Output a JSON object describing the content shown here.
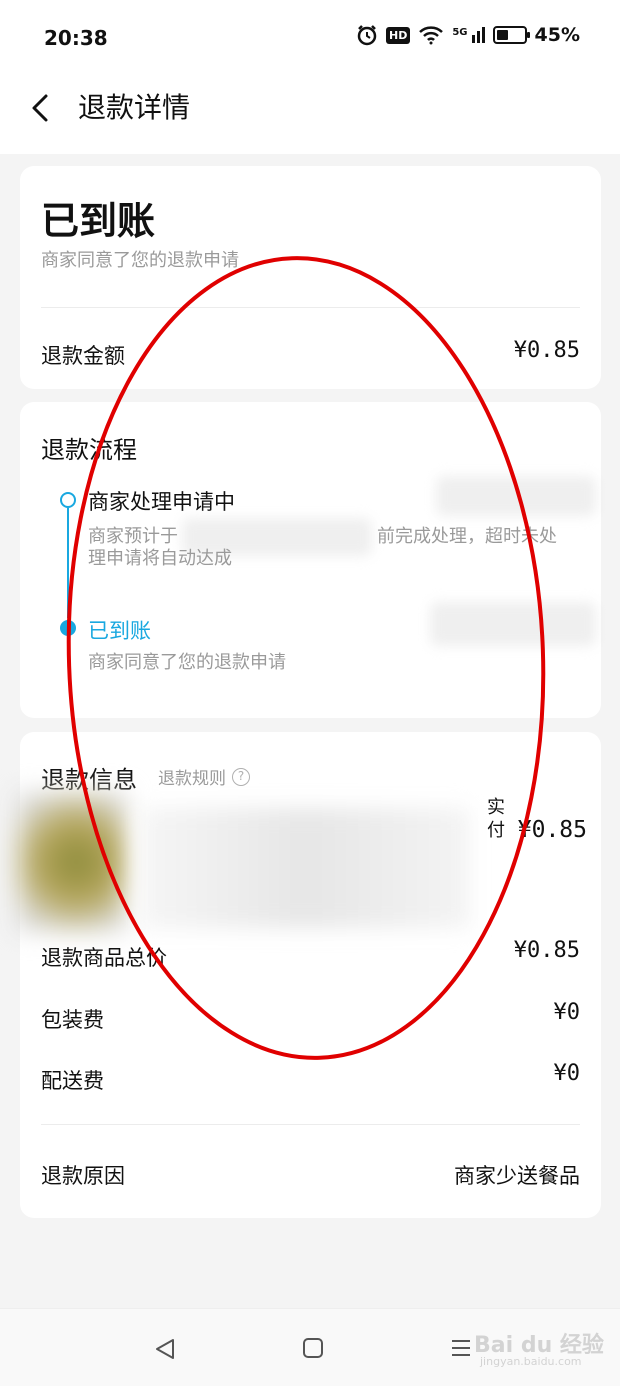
{
  "status_bar": {
    "time": "20:38",
    "hd": "HD",
    "network": "5G",
    "battery": "45%",
    "battery_level": 0.45
  },
  "header": {
    "title": "退款详情"
  },
  "summary": {
    "status": "已到账",
    "subtitle": "商家同意了您的退款申请",
    "amount_label": "退款金额",
    "amount_value": "¥0.85"
  },
  "process": {
    "title": "退款流程",
    "steps": [
      {
        "title": "商家处理申请中",
        "desc_prefix": "商家预计于",
        "desc_suffix": "前完成处理，超时未处",
        "desc_line2": "理申请将自动达成"
      },
      {
        "title": "已到账",
        "desc": "商家同意了您的退款申请"
      }
    ]
  },
  "info": {
    "title": "退款信息",
    "rules_link": "退款规则",
    "paid_label": "实付",
    "paid_amount": "¥0.85",
    "rows": [
      {
        "label": "退款商品总价",
        "value": "¥0.85"
      },
      {
        "label": "包装费",
        "value": "¥0"
      },
      {
        "label": "配送费",
        "value": "¥0"
      }
    ],
    "reason_label": "退款原因",
    "reason_value": "商家少送餐品"
  },
  "watermark": {
    "text": "Bai du 经验",
    "sub": "jingyan.baidu.com"
  },
  "colors": {
    "accent": "#19a8e0",
    "annotation": "#e00000"
  }
}
